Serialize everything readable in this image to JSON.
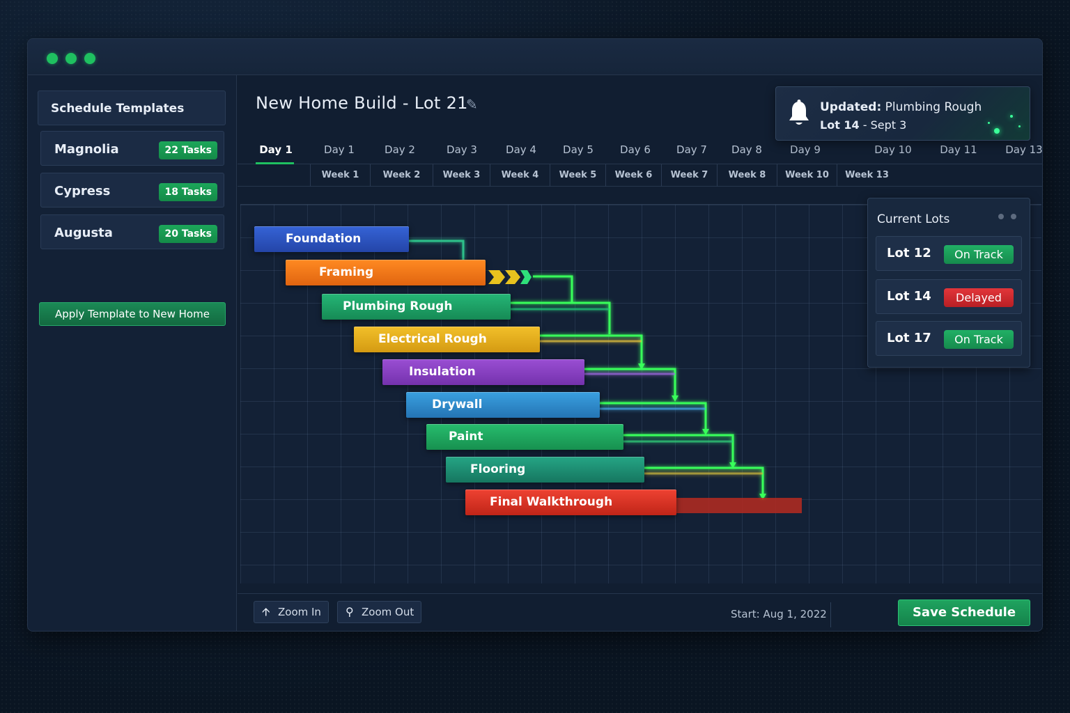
{
  "window": {
    "controls": [
      "green-dot",
      "green-dot",
      "green-dot"
    ]
  },
  "sidebar": {
    "header": "Schedule Templates",
    "templates": [
      {
        "name": "Magnolia",
        "tasks": "22 Tasks"
      },
      {
        "name": "Cypress",
        "tasks": "18 Tasks"
      },
      {
        "name": "Augusta",
        "tasks": "20 Tasks"
      }
    ],
    "apply_label": "Apply Template to New Home"
  },
  "main": {
    "title": "New Home Build - Lot 21",
    "edit_icon": "pencil-icon",
    "days": [
      "Day 1",
      "Day 1",
      "Day 2",
      "Day 3",
      "Day 4",
      "Day 5",
      "Day 6",
      "Day 7",
      "Day 8",
      "Day 9",
      "Day 10",
      "Day 11",
      "Day 13"
    ],
    "weeks": [
      "Week 1",
      "Week 2",
      "Week 3",
      "Week 4",
      "Week 5",
      "Week 6",
      "Week 7",
      "Week 8",
      "Week 10",
      "Week 13"
    ]
  },
  "notification": {
    "icon": "bell-icon",
    "prefix": "Updated:",
    "task": "Plumbing Rough",
    "lot": "Lot 14",
    "date": "- Sept 3"
  },
  "gantt": {
    "tasks": [
      {
        "name": "Foundation",
        "color": "#2f56c7"
      },
      {
        "name": "Framing",
        "color": "#f07a1a"
      },
      {
        "name": "Plumbing Rough",
        "color": "#1ea46a"
      },
      {
        "name": "Electrical Rough",
        "color": "#e7b21e"
      },
      {
        "name": "Insulation",
        "color": "#8a3fc2"
      },
      {
        "name": "Drywall",
        "color": "#2f8fd0"
      },
      {
        "name": "Paint",
        "color": "#1fae63"
      },
      {
        "name": "Flooring",
        "color": "#1f9877"
      },
      {
        "name": "Final Walkthrough",
        "color": "#e2352a"
      }
    ]
  },
  "lots_panel": {
    "header": "Current Lots",
    "lots": [
      {
        "name": "Lot 12",
        "status": "On Track",
        "status_color": "#1fa35f"
      },
      {
        "name": "Lot 14",
        "status": "Delayed",
        "status_color": "#d62c2c"
      },
      {
        "name": "Lot 17",
        "status": "On Track",
        "status_color": "#1fa35f"
      }
    ]
  },
  "footer": {
    "zoom_in": "Zoom In",
    "zoom_out": "Zoom Out",
    "start": "Start: Aug 1, 2022",
    "save": "Save Schedule"
  },
  "colors": {
    "accent": "#1fc060",
    "background": "#0a1522"
  }
}
